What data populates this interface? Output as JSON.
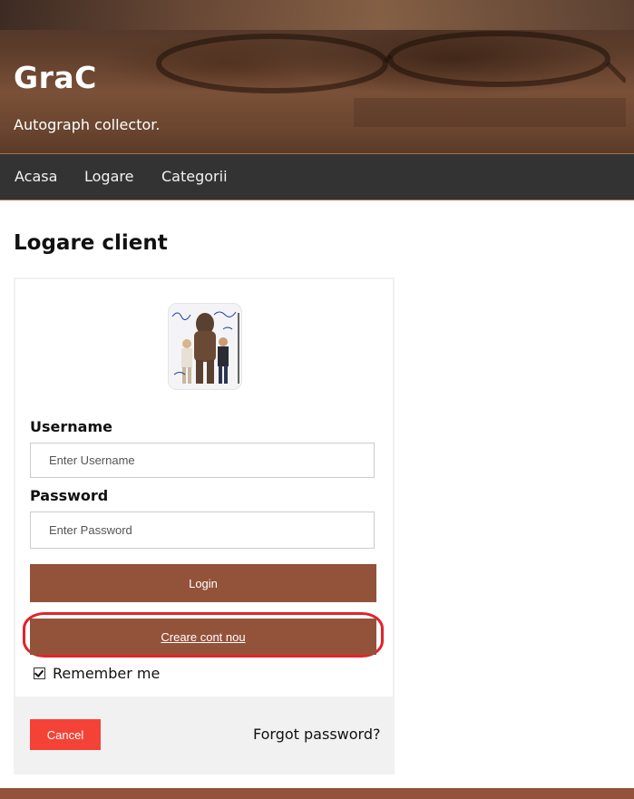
{
  "header": {
    "site_title": "GraC",
    "tagline": "Autograph collector."
  },
  "nav": {
    "items": [
      {
        "label": "Acasa"
      },
      {
        "label": "Logare"
      },
      {
        "label": "Categorii"
      }
    ]
  },
  "main": {
    "heading": "Logare client"
  },
  "login_form": {
    "username_label": "Username",
    "username_placeholder": "Enter Username",
    "username_value": "",
    "password_label": "Password",
    "password_placeholder": "Enter Password",
    "password_value": "",
    "login_button": "Login",
    "create_account_button": "Creare cont nou",
    "remember_label": "Remember me",
    "remember_checked": true,
    "cancel_button": "Cancel",
    "forgot_password": "Forgot password?"
  },
  "colors": {
    "nav_background": "#333333",
    "accent_brown": "#93523a",
    "cancel_red": "#f44336",
    "highlight_red": "#e2232b",
    "footer_gray": "#f1f1f1"
  },
  "icons": {
    "avatar": "autograph-photo-image",
    "remember_checkbox": "checkbox-checked-icon"
  }
}
